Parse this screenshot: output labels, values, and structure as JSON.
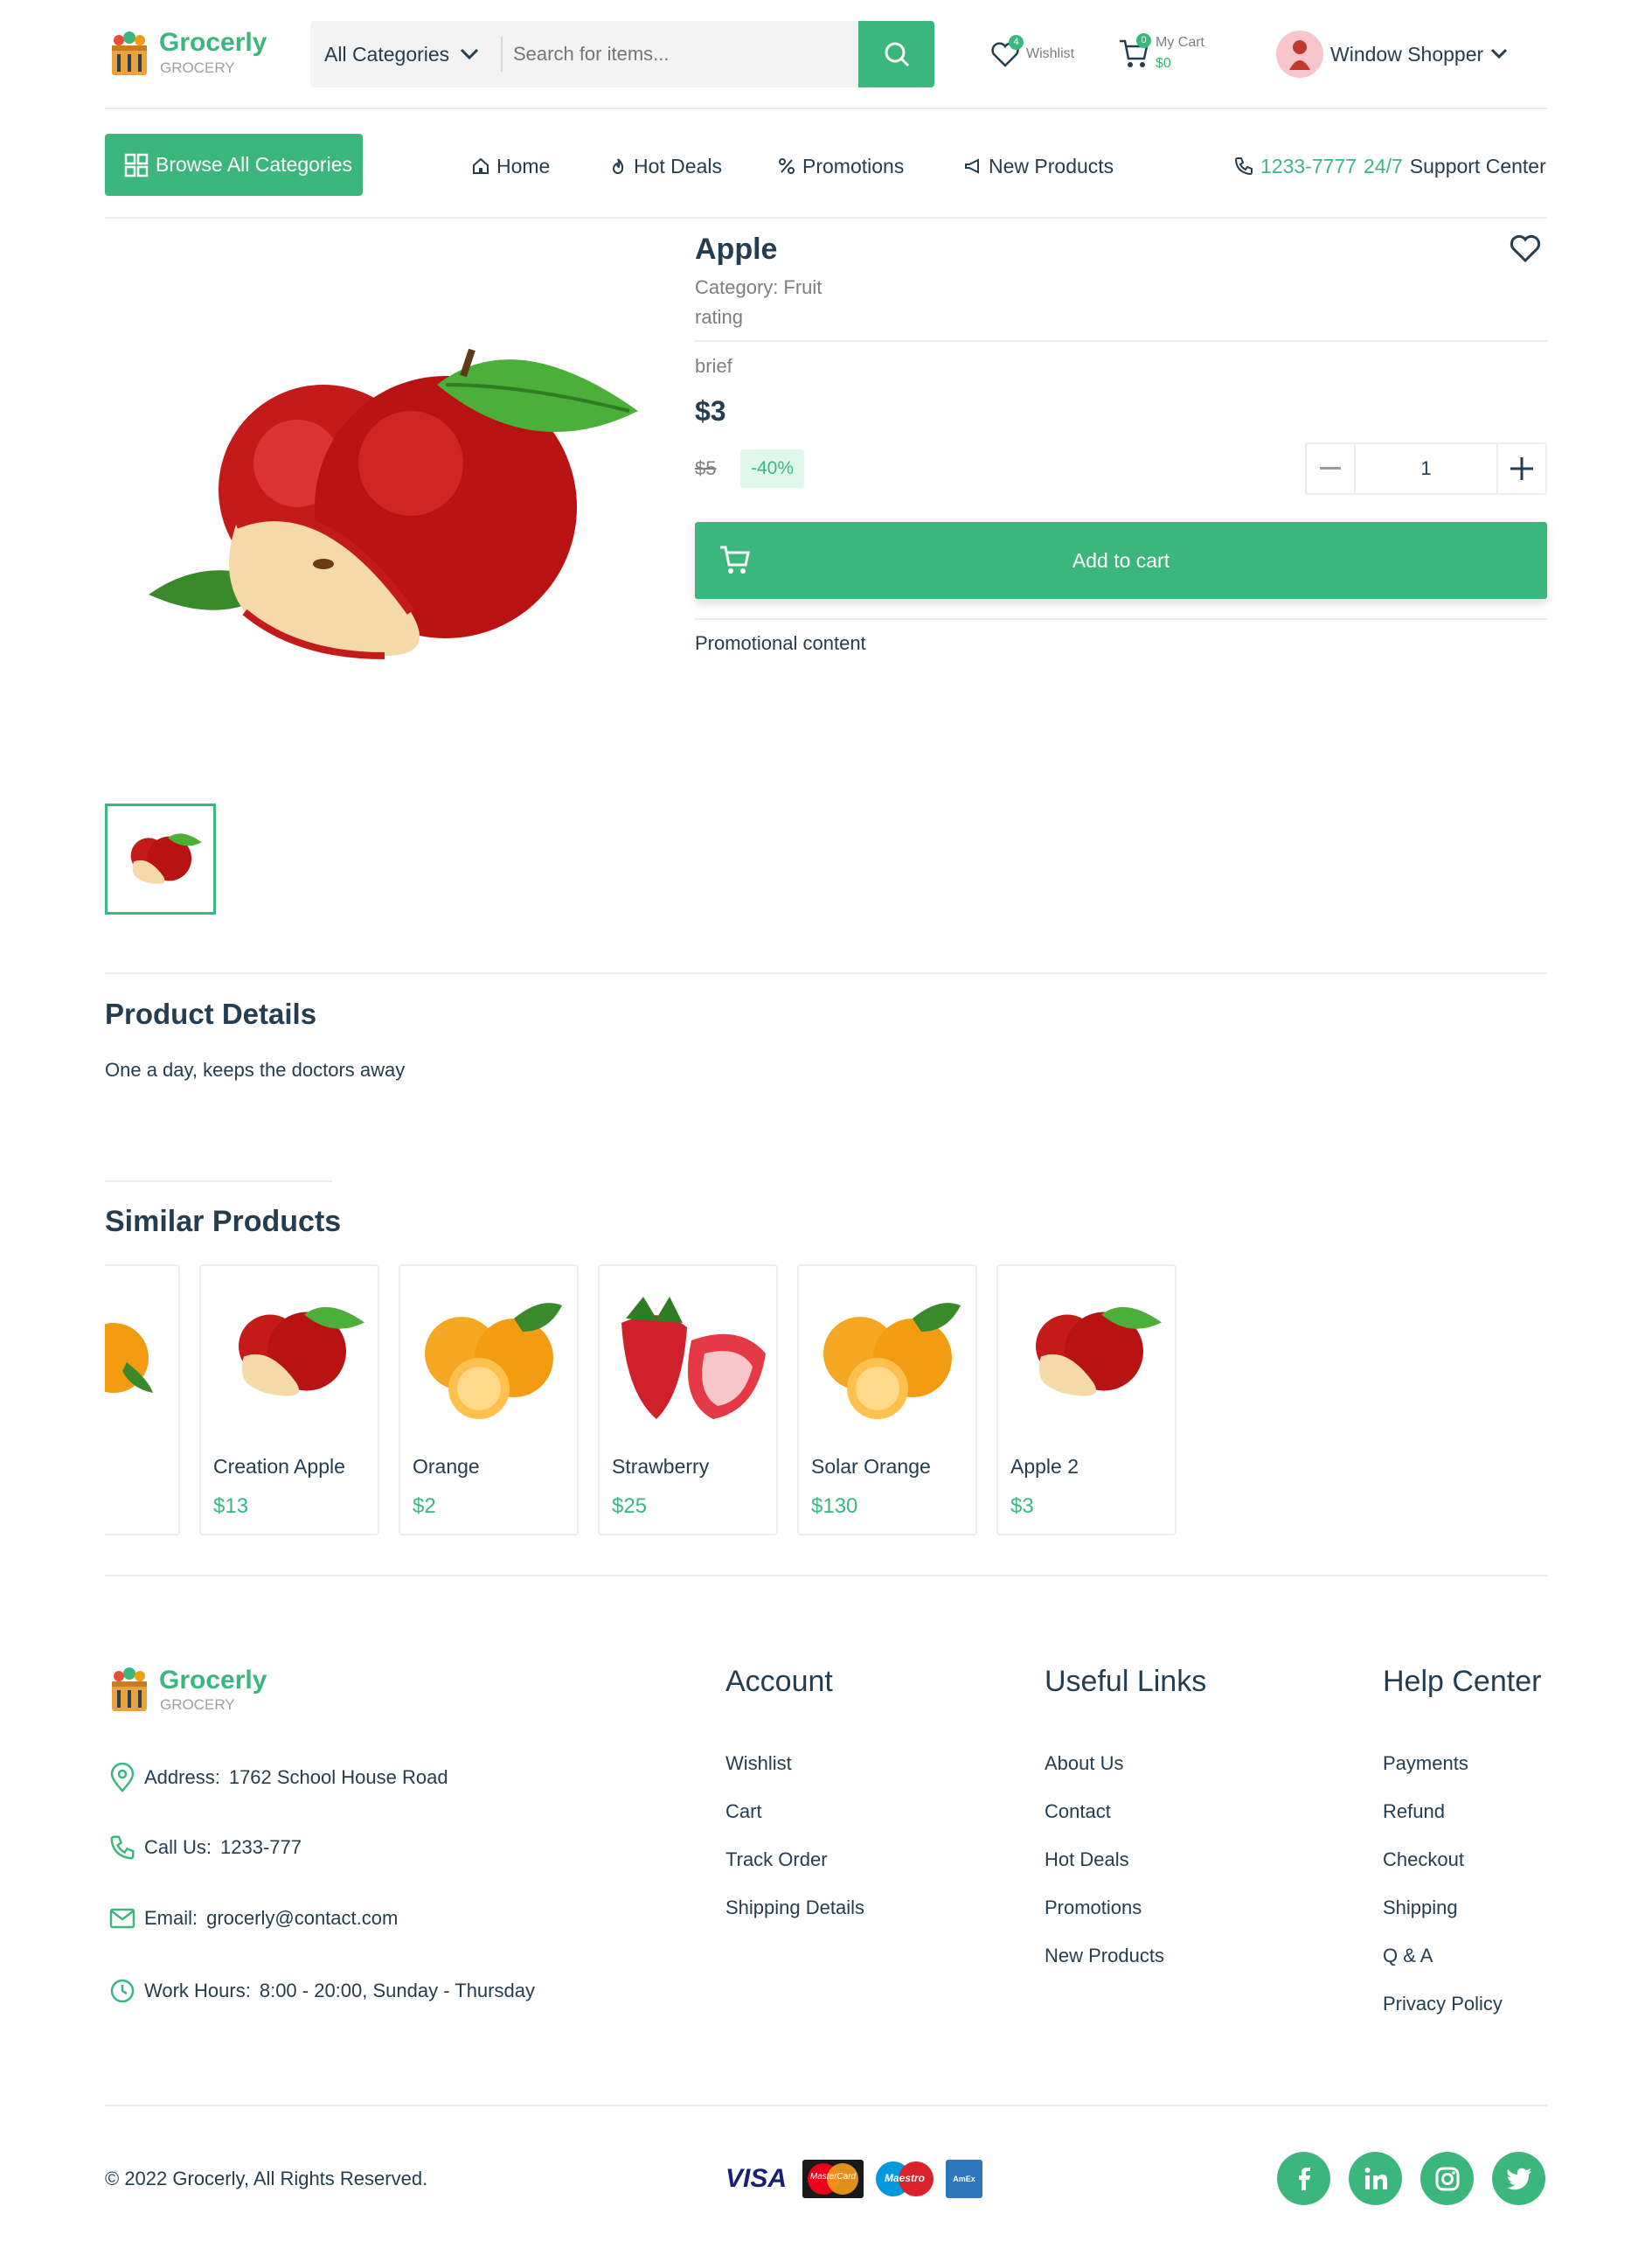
{
  "header": {
    "brand": "Grocerly",
    "brand_sub": "GROCERY",
    "category_select": "All Categories",
    "search_placeholder": "Search for items...",
    "wishlist_label": "Wishlist",
    "wishlist_count": "4",
    "cart_label": "My Cart",
    "cart_count": "0",
    "cart_total": "$0",
    "user_name": "Window Shopper"
  },
  "nav": {
    "browse_label": "Browse All Categories",
    "items": [
      "Home",
      "Hot Deals",
      "Promotions",
      "New Products"
    ],
    "support_phone": "1233-7777",
    "support_hours": "24/7",
    "support_label": "Support Center"
  },
  "product": {
    "name": "Apple",
    "category_label": "Category:",
    "category": "Fruit",
    "rating": "rating",
    "brief": "brief",
    "price": "$3",
    "old_price": "$5",
    "discount": "-40%",
    "quantity": "1",
    "add_to_cart": "Add to cart",
    "promo": "Promotional content"
  },
  "details": {
    "title": "Product Details",
    "text": "One a day, keeps the doctors away"
  },
  "similar": {
    "title": "Similar Products",
    "items": [
      {
        "name": "Creation Apple",
        "price": "$13",
        "icon": "apple-image"
      },
      {
        "name": "Orange",
        "price": "$2",
        "icon": "orange-image"
      },
      {
        "name": "Strawberry",
        "price": "$25",
        "icon": "strawberry-image"
      },
      {
        "name": "Solar Orange",
        "price": "$130",
        "icon": "orange-image"
      },
      {
        "name": "Apple 2",
        "price": "$3",
        "icon": "apple-image"
      }
    ]
  },
  "footer": {
    "brand": "Grocerly",
    "brand_sub": "GROCERY",
    "address_label": "Address:",
    "address": "1762 School House Road",
    "call_label": "Call Us:",
    "call": "1233-777",
    "email_label": "Email:",
    "email": "grocerly@contact.com",
    "hours_label": "Work Hours:",
    "hours": "8:00 - 20:00, Sunday - Thursday",
    "account": {
      "title": "Account",
      "links": [
        "Wishlist",
        "Cart",
        "Track Order",
        "Shipping Details"
      ]
    },
    "useful": {
      "title": "Useful Links",
      "links": [
        "About Us",
        "Contact",
        "Hot Deals",
        "Promotions",
        "New Products"
      ]
    },
    "help": {
      "title": "Help Center",
      "links": [
        "Payments",
        "Refund",
        "Checkout",
        "Shipping",
        "Q & A",
        "Privacy Policy"
      ]
    },
    "copyright": "© 2022 Grocerly, All Rights Reserved.",
    "payments": [
      "VISA",
      "MasterCard",
      "Maestro",
      "AmEx"
    ],
    "social": [
      "facebook-icon",
      "linkedin-icon",
      "instagram-icon",
      "twitter-icon"
    ]
  },
  "colors": {
    "accent": "#3bb77e",
    "text": "#253d4e",
    "muted": "#7e7e7e",
    "badge_bg": "#def9ec"
  }
}
